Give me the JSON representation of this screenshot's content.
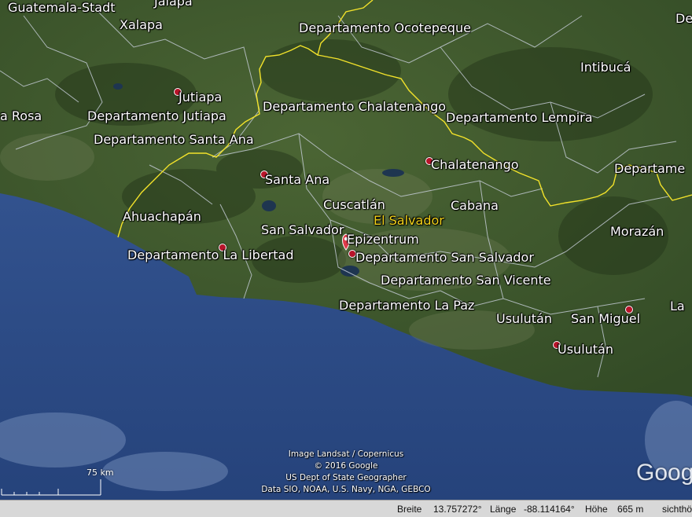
{
  "map": {
    "colors": {
      "land": "#3f5a2e",
      "ocean": "#2f4f8c",
      "border_international": "#f2e22a",
      "border_admin": "#c9d0dc",
      "country_label": "#f2d21a",
      "marker": "#b8142a"
    },
    "labels": {
      "guatemala_stadt": "Guatemala-Stadt",
      "jalapa": "Jalapa",
      "xalapa": "Xalapa",
      "ocotepeque": "Departamento Ocotepeque",
      "intibuca": "Intibucá",
      "rosa": "a Rosa",
      "jutiapa": "Jutiapa",
      "dep_jutiapa": "Departamento Jutiapa",
      "dep_chalatenango": "Departamento Chalatenango",
      "dep_lempira": "Departamento Lempira",
      "dep_santa_ana": "Departamento Santa Ana",
      "chalatenango": "Chalatenango",
      "departame": "Departame",
      "santa_ana": "Santa Ana",
      "ahuachapan": "Ahuachapán",
      "cuscatlan": "Cuscatlán",
      "el_salvador": "El Salvador",
      "cabana": "Cabana",
      "san_salvador": "San Salvador",
      "epizentrum": "Epizentrum",
      "morazan": "Morazán",
      "dep_la_libertad": "Departamento La Libertad",
      "dep_san_salvador": "Departamento San Salvador",
      "dep_san_vicente": "Departamento San Vicente",
      "dep_la_paz": "Departamento La Paz",
      "usulutan_dep": "Usulután",
      "san_miguel": "San Miguel",
      "la": "La",
      "usulutan": "Usulután",
      "de": "De"
    }
  },
  "attribution": {
    "line1": "Image Landsat / Copernicus",
    "line2": "© 2016 Google",
    "line3": "US Dept of State Geographer",
    "line4": "Data SIO, NOAA, U.S. Navy, NGA, GEBCO"
  },
  "logo": "Goog",
  "scale": {
    "label": "75 km"
  },
  "statusbar": {
    "breite_label": "Breite",
    "breite_value": "13.757272°",
    "laenge_label": "Länge",
    "laenge_value": "-88.114164°",
    "hoehe_label": "Höhe",
    "hoehe_value": "665 m",
    "sicht": "sichthö"
  }
}
